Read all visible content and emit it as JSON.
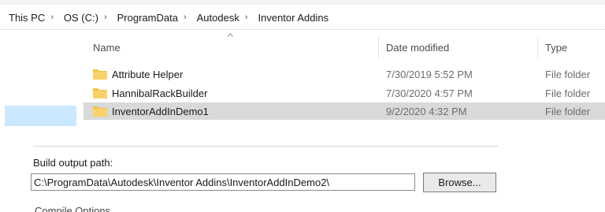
{
  "breadcrumb": {
    "items": [
      "This PC",
      "OS (C:)",
      "ProgramData",
      "Autodesk",
      "Inventor Addins"
    ],
    "separator": "›"
  },
  "file_list": {
    "columns": {
      "name": "Name",
      "date": "Date modified",
      "type": "Type"
    },
    "rows": [
      {
        "name": "Attribute Helper",
        "date": "7/30/2019 5:52 PM",
        "type": "File folder",
        "selected": false
      },
      {
        "name": "HannibalRackBuilder",
        "date": "7/30/2020 4:57 PM",
        "type": "File folder",
        "selected": false
      },
      {
        "name": "InventorAddInDemo1",
        "date": "9/2/2020 4:32 PM",
        "type": "File folder",
        "selected": true
      }
    ]
  },
  "build_panel": {
    "label": "Build output path:",
    "path_value": "C:\\ProgramData\\Autodesk\\Inventor Addins\\InventorAddInDemo2\\",
    "browse_label": "Browse...",
    "cut_off_text": "Compile Options"
  },
  "colors": {
    "selected_row": "#d9d9d9",
    "nav_highlight": "#cce8ff",
    "folder_yellow": "#f5c242"
  },
  "icons": {
    "folder": "folder-icon",
    "sort": "sort-up-arrow-icon"
  }
}
